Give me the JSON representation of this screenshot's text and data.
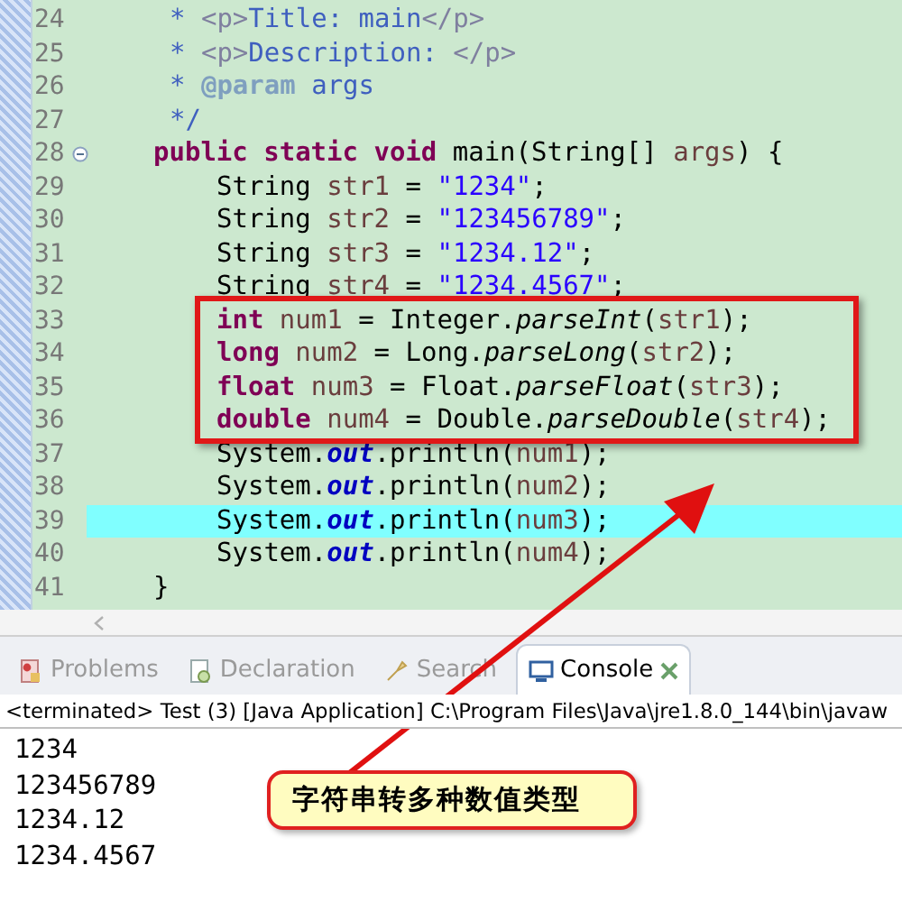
{
  "editor": {
    "lines": [
      {
        "number": "24",
        "kind": "doc",
        "current": false,
        "foldable": false,
        "tokens": [
          {
            "kind": "comment",
            "t": "* "
          },
          {
            "kind": "tag",
            "t": "<p>"
          },
          {
            "kind": "comment",
            "t": "Title: main"
          },
          {
            "kind": "tag",
            "t": "</p>"
          }
        ]
      },
      {
        "number": "25",
        "kind": "doc",
        "current": false,
        "foldable": false,
        "tokens": [
          {
            "kind": "comment",
            "t": "* "
          },
          {
            "kind": "tag",
            "t": "<p>"
          },
          {
            "kind": "comment",
            "t": "Description: "
          },
          {
            "kind": "tag",
            "t": "</p>"
          }
        ]
      },
      {
        "number": "26",
        "kind": "doc",
        "current": false,
        "foldable": false,
        "tokens": [
          {
            "kind": "comment",
            "t": "* "
          },
          {
            "kind": "doctag",
            "t": "@param"
          },
          {
            "kind": "comment",
            "t": " args"
          }
        ]
      },
      {
        "number": "27",
        "kind": "doc",
        "current": false,
        "foldable": false,
        "tokens": [
          {
            "kind": "comment",
            "t": "*/"
          }
        ]
      },
      {
        "number": "28",
        "kind": "member",
        "current": false,
        "foldable": true,
        "tokens": [
          {
            "kind": "kw",
            "t": "public static void"
          },
          {
            "kind": "plain",
            "t": " main(String[] "
          },
          {
            "kind": "var",
            "t": "args"
          },
          {
            "kind": "plain",
            "t": ") {"
          }
        ]
      },
      {
        "number": "29",
        "kind": "body",
        "current": false,
        "foldable": false,
        "tokens": [
          {
            "kind": "plain",
            "t": "String "
          },
          {
            "kind": "var",
            "t": "str1"
          },
          {
            "kind": "plain",
            "t": " = "
          },
          {
            "kind": "str",
            "t": "\"1234\""
          },
          {
            "kind": "plain",
            "t": ";"
          }
        ]
      },
      {
        "number": "30",
        "kind": "body",
        "current": false,
        "foldable": false,
        "tokens": [
          {
            "kind": "plain",
            "t": "String "
          },
          {
            "kind": "var",
            "t": "str2"
          },
          {
            "kind": "plain",
            "t": " = "
          },
          {
            "kind": "str",
            "t": "\"123456789\""
          },
          {
            "kind": "plain",
            "t": ";"
          }
        ]
      },
      {
        "number": "31",
        "kind": "body",
        "current": false,
        "foldable": false,
        "tokens": [
          {
            "kind": "plain",
            "t": "String "
          },
          {
            "kind": "var",
            "t": "str3"
          },
          {
            "kind": "plain",
            "t": " = "
          },
          {
            "kind": "str",
            "t": "\"1234.12\""
          },
          {
            "kind": "plain",
            "t": ";"
          }
        ]
      },
      {
        "number": "32",
        "kind": "body",
        "current": false,
        "foldable": false,
        "tokens": [
          {
            "kind": "plain",
            "t": "String "
          },
          {
            "kind": "var",
            "t": "str4"
          },
          {
            "kind": "plain",
            "t": " = "
          },
          {
            "kind": "str",
            "t": "\"1234.4567\""
          },
          {
            "kind": "plain",
            "t": ";"
          }
        ]
      },
      {
        "number": "33",
        "kind": "body",
        "current": false,
        "foldable": false,
        "tokens": [
          {
            "kind": "kw",
            "t": "int"
          },
          {
            "kind": "var",
            "t": " num1"
          },
          {
            "kind": "plain",
            "t": " = Integer."
          },
          {
            "kind": "static",
            "t": "parseInt"
          },
          {
            "kind": "plain",
            "t": "("
          },
          {
            "kind": "var",
            "t": "str1"
          },
          {
            "kind": "plain",
            "t": ");"
          }
        ]
      },
      {
        "number": "34",
        "kind": "body",
        "current": false,
        "foldable": false,
        "tokens": [
          {
            "kind": "kw",
            "t": "long"
          },
          {
            "kind": "var",
            "t": " num2"
          },
          {
            "kind": "plain",
            "t": " = Long."
          },
          {
            "kind": "static",
            "t": "parseLong"
          },
          {
            "kind": "plain",
            "t": "("
          },
          {
            "kind": "var",
            "t": "str2"
          },
          {
            "kind": "plain",
            "t": ");"
          }
        ]
      },
      {
        "number": "35",
        "kind": "body",
        "current": false,
        "foldable": false,
        "tokens": [
          {
            "kind": "kw",
            "t": "float"
          },
          {
            "kind": "var",
            "t": " num3"
          },
          {
            "kind": "plain",
            "t": " = Float."
          },
          {
            "kind": "static",
            "t": "parseFloat"
          },
          {
            "kind": "plain",
            "t": "("
          },
          {
            "kind": "var",
            "t": "str3"
          },
          {
            "kind": "plain",
            "t": ");"
          }
        ]
      },
      {
        "number": "36",
        "kind": "body",
        "current": false,
        "foldable": false,
        "tokens": [
          {
            "kind": "kw",
            "t": "double"
          },
          {
            "kind": "var",
            "t": " num4"
          },
          {
            "kind": "plain",
            "t": " = Double."
          },
          {
            "kind": "static",
            "t": "parseDouble"
          },
          {
            "kind": "plain",
            "t": "("
          },
          {
            "kind": "var",
            "t": "str4"
          },
          {
            "kind": "plain",
            "t": ");"
          }
        ]
      },
      {
        "number": "37",
        "kind": "body",
        "current": false,
        "foldable": false,
        "tokens": [
          {
            "kind": "plain",
            "t": "System."
          },
          {
            "kind": "field",
            "t": "out"
          },
          {
            "kind": "plain",
            "t": ".println("
          },
          {
            "kind": "var",
            "t": "num1"
          },
          {
            "kind": "plain",
            "t": ");"
          }
        ]
      },
      {
        "number": "38",
        "kind": "body",
        "current": false,
        "foldable": false,
        "tokens": [
          {
            "kind": "plain",
            "t": "System."
          },
          {
            "kind": "field",
            "t": "out"
          },
          {
            "kind": "plain",
            "t": ".println("
          },
          {
            "kind": "var",
            "t": "num2"
          },
          {
            "kind": "plain",
            "t": ");"
          }
        ]
      },
      {
        "number": "39",
        "kind": "body",
        "current": true,
        "foldable": false,
        "tokens": [
          {
            "kind": "plain",
            "t": "System."
          },
          {
            "kind": "field",
            "t": "out"
          },
          {
            "kind": "plain",
            "t": ".println("
          },
          {
            "kind": "var",
            "t": "num3"
          },
          {
            "kind": "plain",
            "t": ");"
          }
        ]
      },
      {
        "number": "40",
        "kind": "body",
        "current": false,
        "foldable": false,
        "tokens": [
          {
            "kind": "plain",
            "t": "System."
          },
          {
            "kind": "field",
            "t": "out"
          },
          {
            "kind": "plain",
            "t": ".println("
          },
          {
            "kind": "var",
            "t": "num4"
          },
          {
            "kind": "plain",
            "t": ");"
          }
        ]
      },
      {
        "number": "41",
        "kind": "member",
        "current": false,
        "foldable": false,
        "tokens": [
          {
            "kind": "plain",
            "t": "}"
          }
        ]
      }
    ]
  },
  "tabs": [
    {
      "label": "Problems",
      "kind": "problems",
      "selected": false
    },
    {
      "label": "Declaration",
      "kind": "declaration",
      "selected": false
    },
    {
      "label": "Search",
      "kind": "search",
      "selected": false
    },
    {
      "label": "Console",
      "kind": "console",
      "selected": true
    }
  ],
  "console": {
    "header": "<terminated> Test (3) [Java Application] C:\\Program Files\\Java\\jre1.8.0_144\\bin\\javaw",
    "output": [
      "1234",
      "123456789",
      "1234.12",
      "1234.4567"
    ]
  },
  "annotation": {
    "callout": "字符串转多种数值类型"
  }
}
